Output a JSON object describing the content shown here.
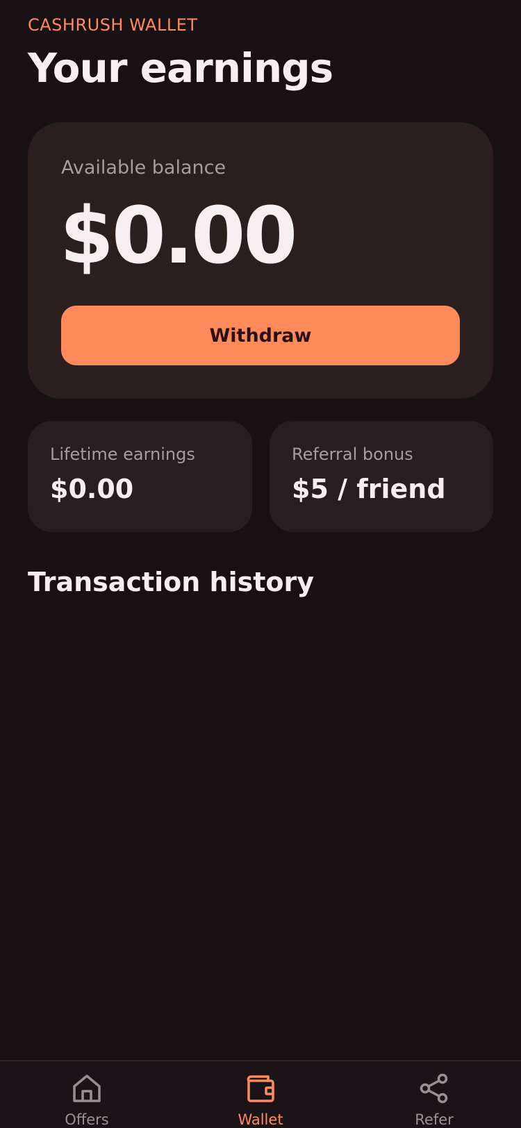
{
  "header": {
    "eyebrow": "CASHRUSH WALLET",
    "title": "Your earnings"
  },
  "balance": {
    "label": "Available balance",
    "amount": "$0.00",
    "withdraw_label": "Withdraw"
  },
  "stats": [
    {
      "label": "Lifetime earnings",
      "value": "$0.00"
    },
    {
      "label": "Referral bonus",
      "value": "$5 / friend"
    }
  ],
  "transactions": {
    "title": "Transaction history",
    "items": []
  },
  "tabbar": {
    "active": "Wallet",
    "items": [
      {
        "label": "Offers",
        "icon": "home-icon"
      },
      {
        "label": "Wallet",
        "icon": "wallet-icon"
      },
      {
        "label": "Refer",
        "icon": "share-icon"
      }
    ]
  },
  "colors": {
    "accent": "#ff8a5c",
    "background": "#171113",
    "card": "#2a1f1e",
    "stat_card": "#271e22",
    "muted_text": "#a69c9e",
    "primary_text": "#f6eef0"
  }
}
